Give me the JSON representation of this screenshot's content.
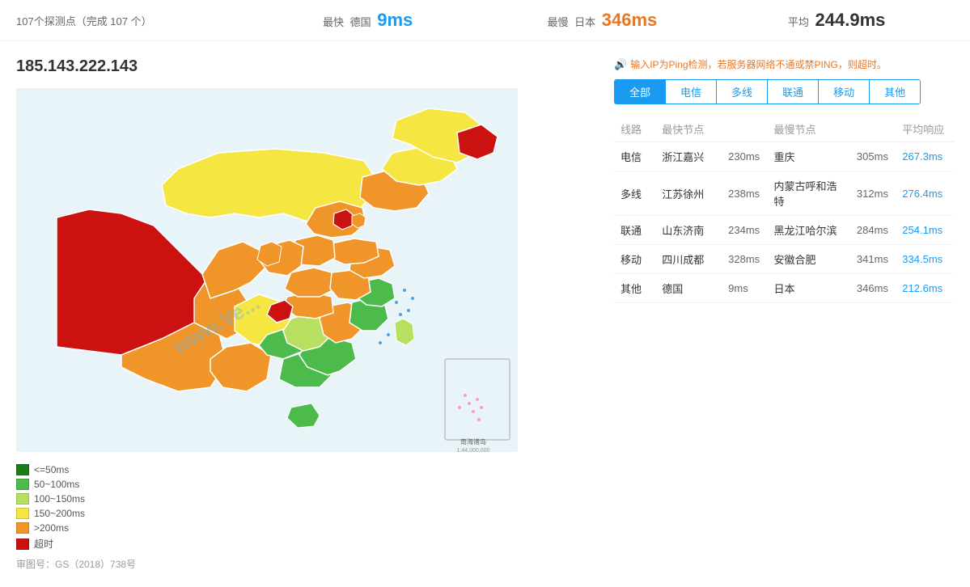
{
  "stats": {
    "probe_count": "107个探测点（完成 107 个）",
    "fastest_label": "最快",
    "fastest_location": "德国",
    "fastest_value": "9ms",
    "slowest_label": "最慢",
    "slowest_location": "日本",
    "slowest_value": "346ms",
    "avg_label": "平均",
    "avg_value": "244.9ms"
  },
  "ip": "185.143.222.143",
  "ping_notice": "输入IP为Ping检测，若服务器网络不通或禁PING，则超时。",
  "tabs": [
    "全部",
    "电信",
    "多线",
    "联通",
    "移动",
    "其他"
  ],
  "active_tab": 0,
  "table": {
    "headers": [
      "线路",
      "最快节点",
      "",
      "最慢节点",
      "",
      "平均响应"
    ],
    "rows": [
      {
        "line": "电信",
        "fast_node": "浙江嘉兴",
        "fast_ms": "230ms",
        "slow_node": "重庆",
        "slow_ms": "305ms",
        "avg": "267.3ms"
      },
      {
        "line": "多线",
        "fast_node": "江苏徐州",
        "fast_ms": "238ms",
        "slow_node": "内蒙古呼和浩特",
        "slow_ms": "312ms",
        "avg": "276.4ms"
      },
      {
        "line": "联通",
        "fast_node": "山东济南",
        "fast_ms": "234ms",
        "slow_node": "黑龙江哈尔滨",
        "slow_ms": "284ms",
        "avg": "254.1ms"
      },
      {
        "line": "移动",
        "fast_node": "四川成都",
        "fast_ms": "328ms",
        "slow_node": "安徽合肥",
        "slow_ms": "341ms",
        "avg": "334.5ms"
      },
      {
        "line": "其他",
        "fast_node": "德国",
        "fast_ms": "9ms",
        "slow_node": "日本",
        "slow_ms": "346ms",
        "avg": "212.6ms"
      }
    ]
  },
  "legend": [
    {
      "color": "#1a7d1a",
      "label": "<=50ms"
    },
    {
      "color": "#4cbb4c",
      "label": "50~100ms"
    },
    {
      "color": "#b8e060",
      "label": "100~150ms"
    },
    {
      "color": "#f5e642",
      "label": "150~200ms"
    },
    {
      "color": "#f0952a",
      "label": ">200ms"
    },
    {
      "color": "#cc1111",
      "label": "超时"
    }
  ],
  "approval": "审图号：GS（2018）738号",
  "watermark": "www.Ve..."
}
